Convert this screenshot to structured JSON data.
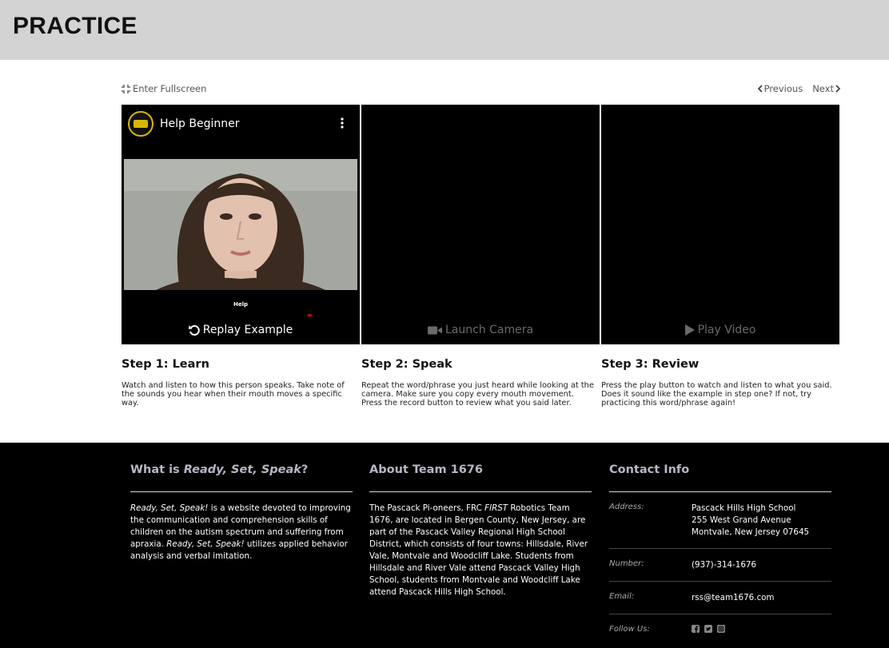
{
  "header": {
    "title": "PRACTICE"
  },
  "toolbar": {
    "fullscreen_label": "Enter Fullscreen",
    "previous_label": "Previous",
    "next_label": "Next"
  },
  "panels": {
    "video_title": "Help Beginner",
    "caption": "Help",
    "replay_label": "Replay Example",
    "camera_label": "Launch Camera",
    "play_label": "Play Video"
  },
  "steps": [
    {
      "title": "Step 1: Learn",
      "text": "Watch and listen to how this person speaks. Take note of the sounds you hear when their mouth moves a specific way."
    },
    {
      "title": "Step 2: Speak",
      "text": "Repeat the word/phrase you just heard while looking at the camera. Make sure you copy every mouth movement. Press the record button to review what you said later."
    },
    {
      "title": "Step 3: Review",
      "text": "Press the play button to watch and listen to what you said. Does it sound like the example in step one? If not, try practicing this word/phrase again!"
    }
  ],
  "footer": {
    "what_title_prefix": "What is ",
    "what_title_em": "Ready, Set, Speak",
    "what_title_suffix": "?",
    "what_em1": "Ready, Set, Speak!",
    "what_text1": " is a website devoted to improving the communication and comprehension skills of children on the autism spectrum and suffering from apraxia. ",
    "what_em2": "Ready, Set, Speak!",
    "what_text2": " utilizes applied behavior analysis and verbal imitation.",
    "about_title": "About Team 1676",
    "about_text1": "The Pascack Pi-oneers, FRC ",
    "about_em": "FIRST",
    "about_text2": " Robotics Team 1676, are located in Bergen County, New Jersey, are part of the Pascack Valley Regional High School District, which consists of four towns: Hillsdale, River Vale, Montvale and Woodcliff Lake. Students from Hillsdale and River Vale attend Pascack Valley High School, students from Montvale and Woodcliff Lake attend Pascack Hills High School.",
    "contact_title": "Contact Info",
    "address_label": "Address:",
    "address_line1": "Pascack Hills High School",
    "address_line2": "255 West Grand Avenue",
    "address_line3": "Montvale, New Jersey 07645",
    "number_label": "Number:",
    "number_value": "(937)-314-1676",
    "email_label": "Email:",
    "email_value": "rss@team1676.com",
    "follow_label": "Follow Us:"
  }
}
